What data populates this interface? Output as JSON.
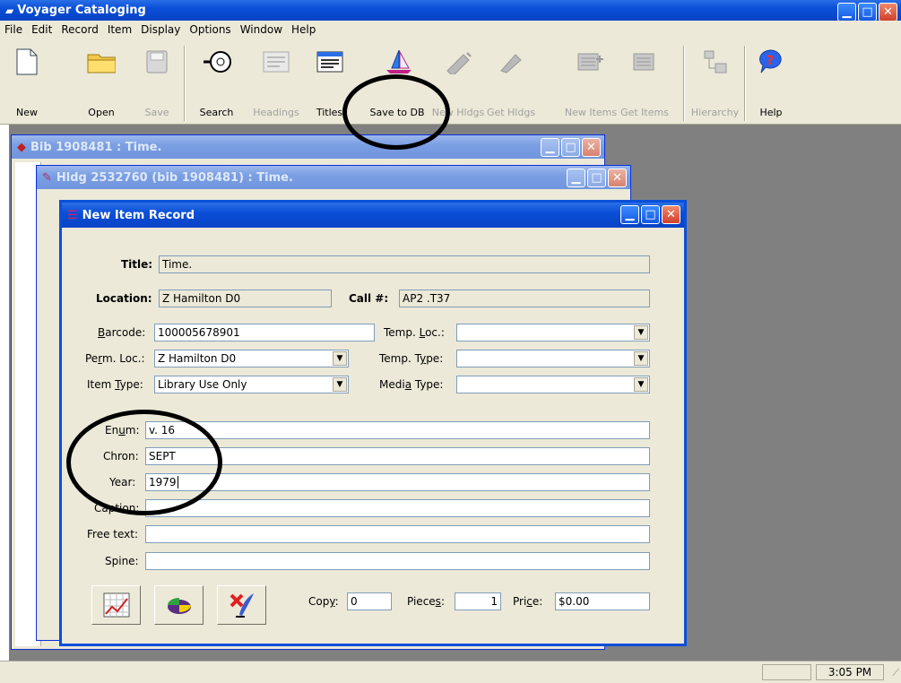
{
  "app": {
    "title": "Voyager Cataloging"
  },
  "menu": [
    "File",
    "Edit",
    "Record",
    "Item",
    "Display",
    "Options",
    "Window",
    "Help"
  ],
  "toolbar": [
    {
      "label": "New",
      "icon": "new-document-icon",
      "enabled": true
    },
    {
      "label": "Open",
      "icon": "open-folder-icon",
      "enabled": true
    },
    {
      "label": "Save",
      "icon": "save-disk-icon",
      "enabled": false
    },
    {
      "label": "Search",
      "icon": "search-icon",
      "enabled": true
    },
    {
      "label": "Headings",
      "icon": "headings-icon",
      "enabled": false
    },
    {
      "label": "Titles",
      "icon": "titles-icon",
      "enabled": true
    },
    {
      "label": "Save to DB",
      "icon": "save-to-db-sailboat-icon",
      "enabled": true
    },
    {
      "label": "New Hldgs",
      "icon": "new-holdings-icon",
      "enabled": false
    },
    {
      "label": "Get Hldgs",
      "icon": "get-holdings-icon",
      "enabled": false
    },
    {
      "label": "New Items",
      "icon": "new-items-icon",
      "enabled": false
    },
    {
      "label": "Get Items",
      "icon": "get-items-icon",
      "enabled": false
    },
    {
      "label": "Hierarchy",
      "icon": "hierarchy-icon",
      "enabled": false
    },
    {
      "label": "Help",
      "icon": "help-icon",
      "enabled": true
    }
  ],
  "windows": {
    "bib": {
      "title": "Bib 1908481 : Time."
    },
    "hldg": {
      "title": "Hldg 2532760 (bib 1908481) : Time."
    },
    "item": {
      "title": "New Item Record"
    }
  },
  "item": {
    "title_label": "Title:",
    "title_value": "Time.",
    "location_label": "Location:",
    "location_value": "Z Hamilton D0",
    "call_label": "Call #:",
    "call_value": "AP2 .T37",
    "barcode_label_pre": "",
    "barcode_label_u": "B",
    "barcode_label_post": "arcode:",
    "barcode_value": "100005678901",
    "perm_loc_label_pre": "Pe",
    "perm_loc_label_u": "r",
    "perm_loc_label_post": "m. Loc.:",
    "perm_loc_value": "Z Hamilton D0",
    "item_type_label_pre": "Item ",
    "item_type_label_u": "T",
    "item_type_label_post": "ype:",
    "item_type_value": "Library Use Only",
    "temp_loc_label_pre": "Temp. ",
    "temp_loc_label_u": "L",
    "temp_loc_label_post": "oc.:",
    "temp_loc_value": "",
    "temp_type_label_pre": "Temp. T",
    "temp_type_label_u": "y",
    "temp_type_label_post": "pe:",
    "temp_type_value": "",
    "media_type_label_pre": "Medi",
    "media_type_label_u": "a",
    "media_type_label_post": " Type:",
    "media_type_value": "",
    "enum_label_pre": "En",
    "enum_label_u": "u",
    "enum_label_post": "m:",
    "enum_value": "v. 16",
    "chron_label": "Chron:",
    "chron_value": "SEPT",
    "year_label": "Year:",
    "year_value": "1979",
    "caption_label": "Caption:",
    "caption_value": "",
    "free_text_label": "Free text:",
    "free_text_value": "",
    "spine_label": "Spine:",
    "spine_value": "",
    "copy_label_pre": "Cop",
    "copy_label_u": "y",
    "copy_label_post": ":",
    "copy_value": "0",
    "pieces_label_pre": "Piece",
    "pieces_label_u": "s",
    "pieces_label_post": ":",
    "pieces_value": "1",
    "price_label_pre": "Pri",
    "price_label_u": "c",
    "price_label_post": "e:",
    "price_value": "$0.00"
  },
  "status": {
    "time": "3:05 PM"
  }
}
